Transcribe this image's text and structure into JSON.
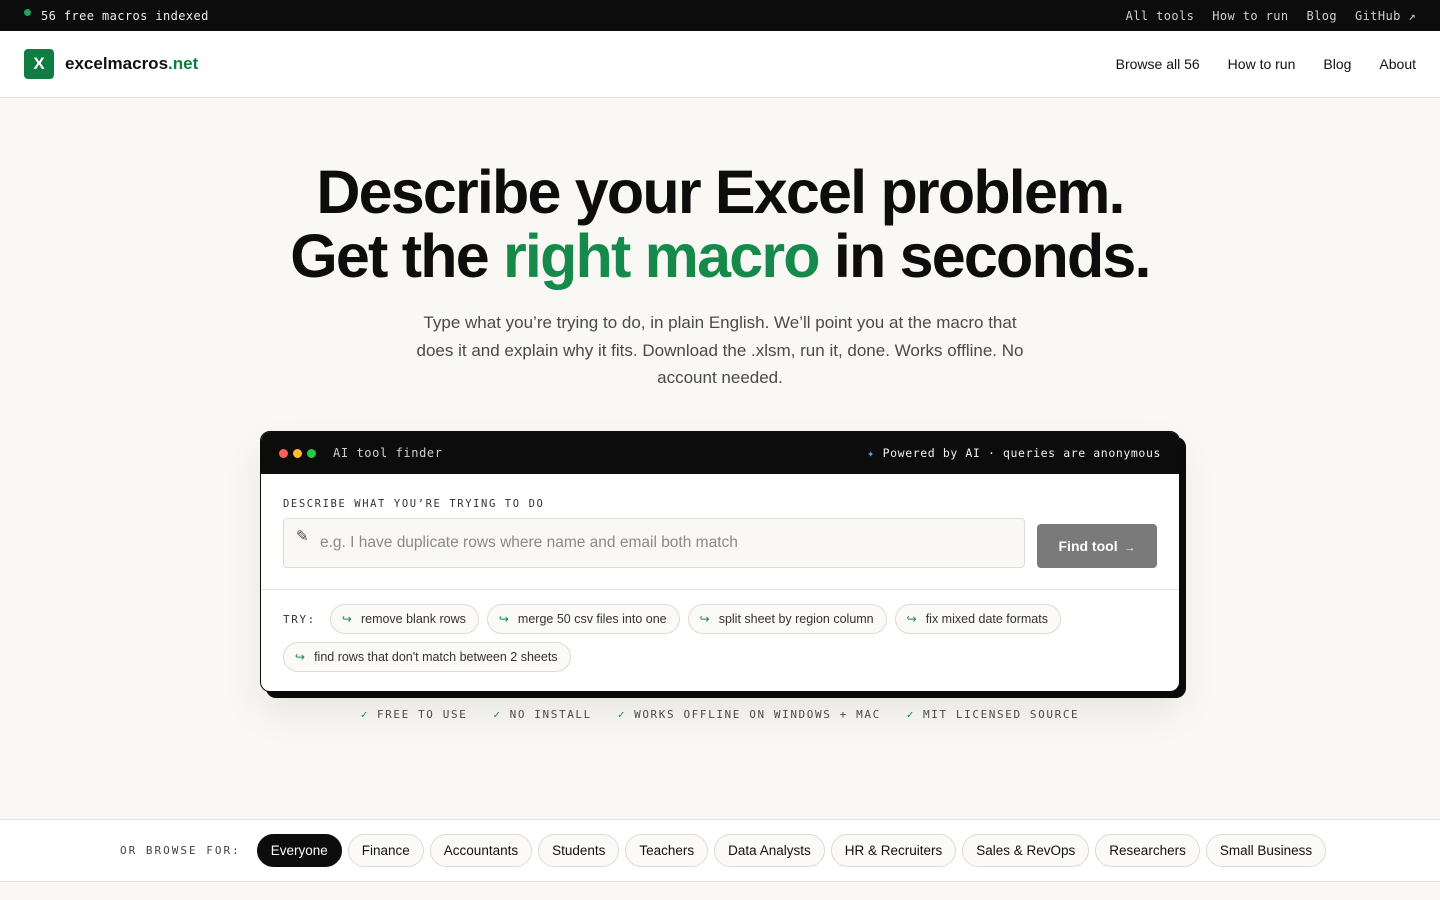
{
  "topbar": {
    "status": "56 free macros indexed",
    "links": [
      "All tools",
      "How to run",
      "Blog",
      "GitHub ↗"
    ]
  },
  "header": {
    "logo_letter": "X",
    "brand_name": "excelmacros",
    "brand_tld": ".net",
    "nav": [
      "Browse all 56",
      "How to run",
      "Blog",
      "About"
    ]
  },
  "hero": {
    "line1": "Describe your Excel problem.",
    "line2_before": "Get the",
    "line2_accent": "right macro",
    "line2_after": "in seconds.",
    "subtitle": "Type what you’re trying to do, in plain English. We’ll point you at the macro that does it and explain why it fits. Download the .xlsm, run it, done. Works offline. No account needed."
  },
  "finder": {
    "window_title": "AI tool finder",
    "powered_icon": "✦",
    "powered_text": "Powered by AI · queries are anonymous",
    "field_label": "DESCRIBE WHAT YOU’RE TRYING TO DO",
    "pencil_icon": "✎",
    "input_value": "",
    "input_placeholder": "e.g. I have duplicate rows where name and email both match",
    "button_label": "Find tool",
    "button_arrow": "→",
    "try_label": "TRY:",
    "chip_icon": "↪",
    "suggestions": [
      "remove blank rows",
      "merge 50 csv files into one",
      "split sheet by region column",
      "fix mixed date formats",
      "find rows that don't match between 2 sheets"
    ]
  },
  "features": {
    "check_icon": "✓",
    "items": [
      "FREE TO USE",
      "NO INSTALL",
      "WORKS OFFLINE ON WINDOWS + MAC",
      "MIT LICENSED SOURCE"
    ]
  },
  "browse": {
    "label": "OR BROWSE FOR:",
    "active_index": 0,
    "audiences": [
      "Everyone",
      "Finance",
      "Accountants",
      "Students",
      "Teachers",
      "Data Analysts",
      "HR & Recruiters",
      "Sales & RevOps",
      "Researchers",
      "Small Business"
    ]
  },
  "colors": {
    "brand_green": "#107c41",
    "accent_green": "#168a4a",
    "dark": "#0c0c0c",
    "button_gray": "#7a7a7a",
    "light_red": "#ff5f57",
    "light_yellow": "#febc2e",
    "light_green": "#28c840"
  }
}
